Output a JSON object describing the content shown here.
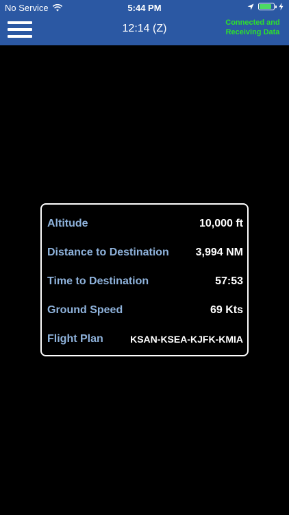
{
  "status_bar": {
    "carrier": "No Service",
    "time": "5:44 PM",
    "battery_fraction": 0.85,
    "battery_color": "#4cd964"
  },
  "header": {
    "background_color": "#2b58a3",
    "menu_icon": "hamburger-menu-icon",
    "zulu_time": "12:14 (Z)",
    "connection_status": "Connected and Receiving Data",
    "connection_color": "#2de02d"
  },
  "flight_info": {
    "label_color": "#8fb3dc",
    "rows": [
      {
        "label": "Altitude",
        "value": "10,000 ft"
      },
      {
        "label": "Distance to Destination",
        "value": "3,994 NM"
      },
      {
        "label": "Time to Destination",
        "value": "57:53"
      },
      {
        "label": "Ground Speed",
        "value": "69 Kts"
      },
      {
        "label": "Flight Plan",
        "value": "KSAN-KSEA-KJFK-KMIA"
      }
    ]
  }
}
